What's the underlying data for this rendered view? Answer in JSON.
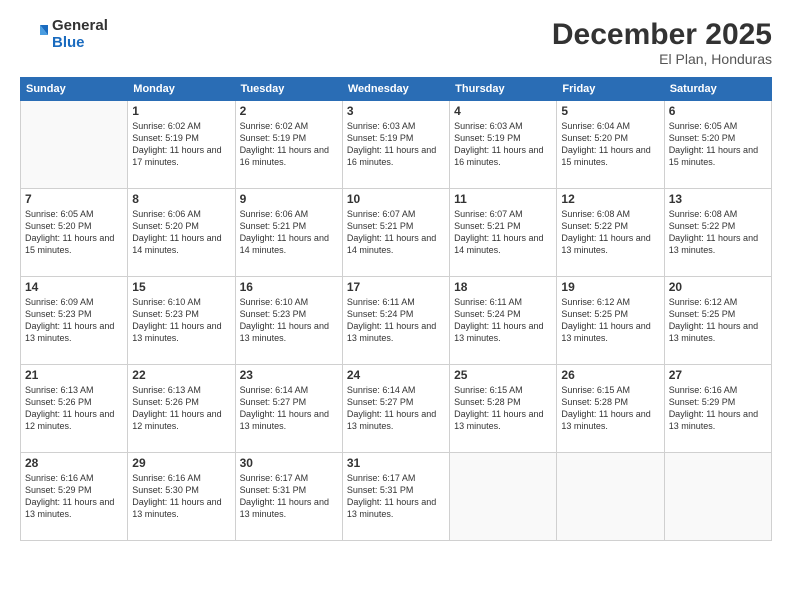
{
  "header": {
    "logo_general": "General",
    "logo_blue": "Blue",
    "month_title": "December 2025",
    "location": "El Plan, Honduras"
  },
  "days_of_week": [
    "Sunday",
    "Monday",
    "Tuesday",
    "Wednesday",
    "Thursday",
    "Friday",
    "Saturday"
  ],
  "weeks": [
    [
      {
        "day": "",
        "sunrise": "",
        "sunset": "",
        "daylight": ""
      },
      {
        "day": "1",
        "sunrise": "Sunrise: 6:02 AM",
        "sunset": "Sunset: 5:19 PM",
        "daylight": "Daylight: 11 hours and 17 minutes."
      },
      {
        "day": "2",
        "sunrise": "Sunrise: 6:02 AM",
        "sunset": "Sunset: 5:19 PM",
        "daylight": "Daylight: 11 hours and 16 minutes."
      },
      {
        "day": "3",
        "sunrise": "Sunrise: 6:03 AM",
        "sunset": "Sunset: 5:19 PM",
        "daylight": "Daylight: 11 hours and 16 minutes."
      },
      {
        "day": "4",
        "sunrise": "Sunrise: 6:03 AM",
        "sunset": "Sunset: 5:19 PM",
        "daylight": "Daylight: 11 hours and 16 minutes."
      },
      {
        "day": "5",
        "sunrise": "Sunrise: 6:04 AM",
        "sunset": "Sunset: 5:20 PM",
        "daylight": "Daylight: 11 hours and 15 minutes."
      },
      {
        "day": "6",
        "sunrise": "Sunrise: 6:05 AM",
        "sunset": "Sunset: 5:20 PM",
        "daylight": "Daylight: 11 hours and 15 minutes."
      }
    ],
    [
      {
        "day": "7",
        "sunrise": "Sunrise: 6:05 AM",
        "sunset": "Sunset: 5:20 PM",
        "daylight": "Daylight: 11 hours and 15 minutes."
      },
      {
        "day": "8",
        "sunrise": "Sunrise: 6:06 AM",
        "sunset": "Sunset: 5:20 PM",
        "daylight": "Daylight: 11 hours and 14 minutes."
      },
      {
        "day": "9",
        "sunrise": "Sunrise: 6:06 AM",
        "sunset": "Sunset: 5:21 PM",
        "daylight": "Daylight: 11 hours and 14 minutes."
      },
      {
        "day": "10",
        "sunrise": "Sunrise: 6:07 AM",
        "sunset": "Sunset: 5:21 PM",
        "daylight": "Daylight: 11 hours and 14 minutes."
      },
      {
        "day": "11",
        "sunrise": "Sunrise: 6:07 AM",
        "sunset": "Sunset: 5:21 PM",
        "daylight": "Daylight: 11 hours and 14 minutes."
      },
      {
        "day": "12",
        "sunrise": "Sunrise: 6:08 AM",
        "sunset": "Sunset: 5:22 PM",
        "daylight": "Daylight: 11 hours and 13 minutes."
      },
      {
        "day": "13",
        "sunrise": "Sunrise: 6:08 AM",
        "sunset": "Sunset: 5:22 PM",
        "daylight": "Daylight: 11 hours and 13 minutes."
      }
    ],
    [
      {
        "day": "14",
        "sunrise": "Sunrise: 6:09 AM",
        "sunset": "Sunset: 5:23 PM",
        "daylight": "Daylight: 11 hours and 13 minutes."
      },
      {
        "day": "15",
        "sunrise": "Sunrise: 6:10 AM",
        "sunset": "Sunset: 5:23 PM",
        "daylight": "Daylight: 11 hours and 13 minutes."
      },
      {
        "day": "16",
        "sunrise": "Sunrise: 6:10 AM",
        "sunset": "Sunset: 5:23 PM",
        "daylight": "Daylight: 11 hours and 13 minutes."
      },
      {
        "day": "17",
        "sunrise": "Sunrise: 6:11 AM",
        "sunset": "Sunset: 5:24 PM",
        "daylight": "Daylight: 11 hours and 13 minutes."
      },
      {
        "day": "18",
        "sunrise": "Sunrise: 6:11 AM",
        "sunset": "Sunset: 5:24 PM",
        "daylight": "Daylight: 11 hours and 13 minutes."
      },
      {
        "day": "19",
        "sunrise": "Sunrise: 6:12 AM",
        "sunset": "Sunset: 5:25 PM",
        "daylight": "Daylight: 11 hours and 13 minutes."
      },
      {
        "day": "20",
        "sunrise": "Sunrise: 6:12 AM",
        "sunset": "Sunset: 5:25 PM",
        "daylight": "Daylight: 11 hours and 13 minutes."
      }
    ],
    [
      {
        "day": "21",
        "sunrise": "Sunrise: 6:13 AM",
        "sunset": "Sunset: 5:26 PM",
        "daylight": "Daylight: 11 hours and 12 minutes."
      },
      {
        "day": "22",
        "sunrise": "Sunrise: 6:13 AM",
        "sunset": "Sunset: 5:26 PM",
        "daylight": "Daylight: 11 hours and 12 minutes."
      },
      {
        "day": "23",
        "sunrise": "Sunrise: 6:14 AM",
        "sunset": "Sunset: 5:27 PM",
        "daylight": "Daylight: 11 hours and 13 minutes."
      },
      {
        "day": "24",
        "sunrise": "Sunrise: 6:14 AM",
        "sunset": "Sunset: 5:27 PM",
        "daylight": "Daylight: 11 hours and 13 minutes."
      },
      {
        "day": "25",
        "sunrise": "Sunrise: 6:15 AM",
        "sunset": "Sunset: 5:28 PM",
        "daylight": "Daylight: 11 hours and 13 minutes."
      },
      {
        "day": "26",
        "sunrise": "Sunrise: 6:15 AM",
        "sunset": "Sunset: 5:28 PM",
        "daylight": "Daylight: 11 hours and 13 minutes."
      },
      {
        "day": "27",
        "sunrise": "Sunrise: 6:16 AM",
        "sunset": "Sunset: 5:29 PM",
        "daylight": "Daylight: 11 hours and 13 minutes."
      }
    ],
    [
      {
        "day": "28",
        "sunrise": "Sunrise: 6:16 AM",
        "sunset": "Sunset: 5:29 PM",
        "daylight": "Daylight: 11 hours and 13 minutes."
      },
      {
        "day": "29",
        "sunrise": "Sunrise: 6:16 AM",
        "sunset": "Sunset: 5:30 PM",
        "daylight": "Daylight: 11 hours and 13 minutes."
      },
      {
        "day": "30",
        "sunrise": "Sunrise: 6:17 AM",
        "sunset": "Sunset: 5:31 PM",
        "daylight": "Daylight: 11 hours and 13 minutes."
      },
      {
        "day": "31",
        "sunrise": "Sunrise: 6:17 AM",
        "sunset": "Sunset: 5:31 PM",
        "daylight": "Daylight: 11 hours and 13 minutes."
      },
      {
        "day": "",
        "sunrise": "",
        "sunset": "",
        "daylight": ""
      },
      {
        "day": "",
        "sunrise": "",
        "sunset": "",
        "daylight": ""
      },
      {
        "day": "",
        "sunrise": "",
        "sunset": "",
        "daylight": ""
      }
    ]
  ]
}
